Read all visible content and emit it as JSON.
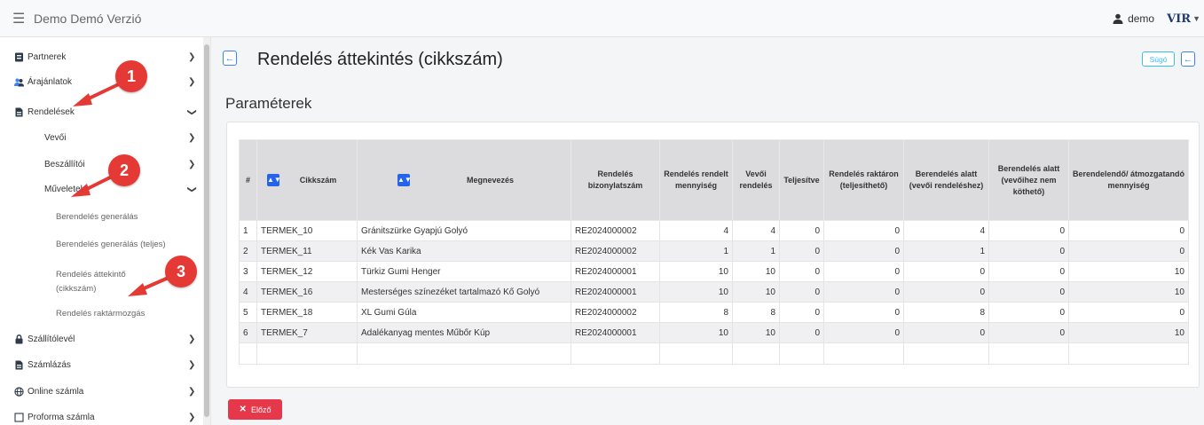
{
  "app": {
    "title": "Demo Demó Verzió"
  },
  "user": {
    "name": "demo"
  },
  "logo": {
    "text": "VIR"
  },
  "sidebar": {
    "items": [
      {
        "label": "Partnerek"
      },
      {
        "label": "Árajánlatok"
      },
      {
        "label": "Rendelések"
      },
      {
        "label": "Vevői"
      },
      {
        "label": "Beszállítói"
      },
      {
        "label": "Műveletek"
      },
      {
        "label": "Berendelés generálás"
      },
      {
        "label": "Berendelés generálás (teljes)"
      },
      {
        "label": "Rendelés áttekintő (cikkszám)"
      },
      {
        "label": "Rendelés raktármozgás"
      },
      {
        "label": "Szállítólevél"
      },
      {
        "label": "Számlázás"
      },
      {
        "label": "Online számla"
      },
      {
        "label": "Proforma számla"
      }
    ]
  },
  "markers": [
    "1",
    "2",
    "3"
  ],
  "colors": {
    "marker": "#e53935",
    "primary": "#3b82f6",
    "info": "#38bdf8",
    "danger": "#e5394b"
  },
  "page": {
    "title": "Rendelés áttekintés (cikkszám)",
    "help_label": "Súgó",
    "section_title": "Paraméterek",
    "close_label": "Előző"
  },
  "table": {
    "headers": {
      "idx": "#",
      "sku": "Cikkszám",
      "name": "Megnevezés",
      "doc": "Rendelés bizonylatszám",
      "ordered": "Rendelés rendelt mennyiség",
      "customer": "Vevői rendelés",
      "done": "Teljesítve",
      "stock": "Rendelés raktáron (teljesíthető)",
      "under": "Berendelés alatt (vevői rendeléshez)",
      "notlinked": "Berendelés alatt (vevőihez nem köthető)",
      "tomove": "Berendelendő/ átmozgatandó mennyiség"
    },
    "rows": [
      {
        "idx": "1",
        "sku": "TERMEK_10",
        "name": "Gránitszürke Gyapjú Golyó",
        "doc": "RE2024000002",
        "ordered": "4",
        "customer": "4",
        "done": "0",
        "stock": "0",
        "under": "4",
        "notlinked": "0",
        "tomove": "0"
      },
      {
        "idx": "2",
        "sku": "TERMEK_11",
        "name": "Kék Vas Karika",
        "doc": "RE2024000002",
        "ordered": "1",
        "customer": "1",
        "done": "0",
        "stock": "0",
        "under": "1",
        "notlinked": "0",
        "tomove": "0"
      },
      {
        "idx": "3",
        "sku": "TERMEK_12",
        "name": "Türkiz Gumi Henger",
        "doc": "RE2024000001",
        "ordered": "10",
        "customer": "10",
        "done": "0",
        "stock": "0",
        "under": "0",
        "notlinked": "0",
        "tomove": "10"
      },
      {
        "idx": "4",
        "sku": "TERMEK_16",
        "name": "Mesterséges színezéket tartalmazó Kő Golyó",
        "doc": "RE2024000001",
        "ordered": "10",
        "customer": "10",
        "done": "0",
        "stock": "0",
        "under": "0",
        "notlinked": "0",
        "tomove": "10"
      },
      {
        "idx": "5",
        "sku": "TERMEK_18",
        "name": "XL Gumi Gúla",
        "doc": "RE2024000002",
        "ordered": "8",
        "customer": "8",
        "done": "0",
        "stock": "0",
        "under": "8",
        "notlinked": "0",
        "tomove": "0"
      },
      {
        "idx": "6",
        "sku": "TERMEK_7",
        "name": "Adalékanyag mentes Műbőr Kúp",
        "doc": "RE2024000001",
        "ordered": "10",
        "customer": "10",
        "done": "0",
        "stock": "0",
        "under": "0",
        "notlinked": "0",
        "tomove": "10"
      }
    ]
  }
}
